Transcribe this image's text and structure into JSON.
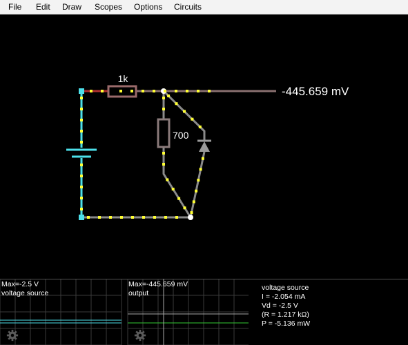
{
  "menu": {
    "items": [
      "File",
      "Edit",
      "Draw",
      "Scopes",
      "Options",
      "Circuits"
    ]
  },
  "circuit": {
    "resistor1_label": "1k",
    "resistor2_label": "700",
    "output_voltage": "-445.659 mV"
  },
  "scopes": {
    "scope1": {
      "max": "Max=-2.5 V",
      "name": "voltage source"
    },
    "scope2": {
      "max": "Max=-445.659 mV",
      "name": "output"
    }
  },
  "info": {
    "title": "voltage source",
    "current": "I = -2.054 mA",
    "vd": "Vd = -2.5 V",
    "resistance": "(R = 1.217 kΩ)",
    "power": "P = -5.136 mW"
  },
  "colors": {
    "wire_live": "#4de0ea",
    "wire_neutral": "#8a8a8a",
    "current_dot": "#ffff33",
    "resistor_hot": "#b03030",
    "scope_trace1": "#4de0ea",
    "scope_trace2": "#33cc33"
  },
  "icons": [
    "gear-icon",
    "gear-icon"
  ]
}
